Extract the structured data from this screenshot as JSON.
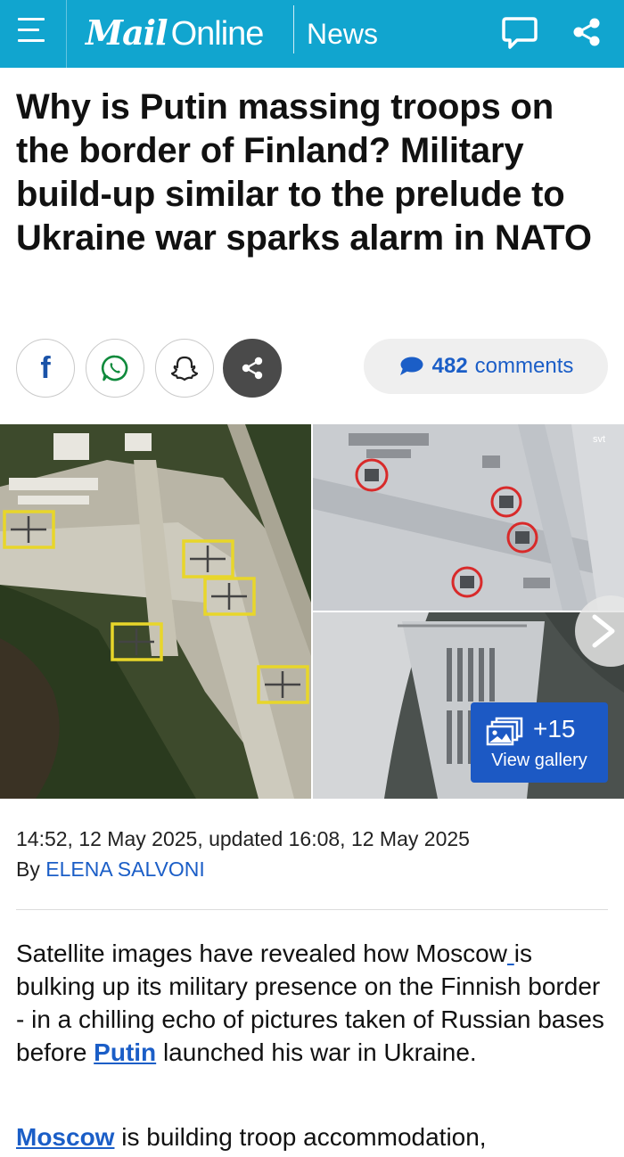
{
  "header": {
    "logo_bold": "Mail",
    "logo_light": "Online",
    "section": "News",
    "menu_icon": "hamburger-menu-icon",
    "comment_icon": "speech-bubble-icon",
    "share_icon": "share-icon",
    "background_color": "#11a5cf"
  },
  "article": {
    "headline": "Why is Putin massing troops on the border of Finland? Military build-up similar to the prelude to Ukraine war sparks alarm in NATO",
    "dateline": "14:52, 12 May 2025, updated 16:08, 12 May 2025",
    "by_prefix": "By",
    "author": "ELENA SALVONI",
    "para1": {
      "text_a": "Satellite images have revealed how Moscow",
      "link_a": " ",
      "text_b": "is bulking up its military presence on the Finnish border - in a chilling echo of pictures taken of Russian bases before ",
      "link_b": "Putin",
      "text_c": " launched his war in Ukraine."
    },
    "para2": {
      "link": "Moscow",
      "text": " is building troop accommodation,"
    }
  },
  "share": {
    "facebook_icon": "facebook-icon",
    "whatsapp_icon": "whatsapp-icon",
    "snapchat_icon": "snapchat-icon",
    "more_share_icon": "share-icon",
    "comment_count": "482",
    "comments_label": "comments"
  },
  "gallery": {
    "watermark": "svt",
    "extra_count": "+15",
    "view_label": "View gallery",
    "next_icon": "chevron-right-icon"
  },
  "colors": {
    "link": "#1b5ec7",
    "gallery_button": "#1c59c4",
    "highlight_box": "#e8d62a",
    "highlight_circle": "#d82a2a"
  }
}
